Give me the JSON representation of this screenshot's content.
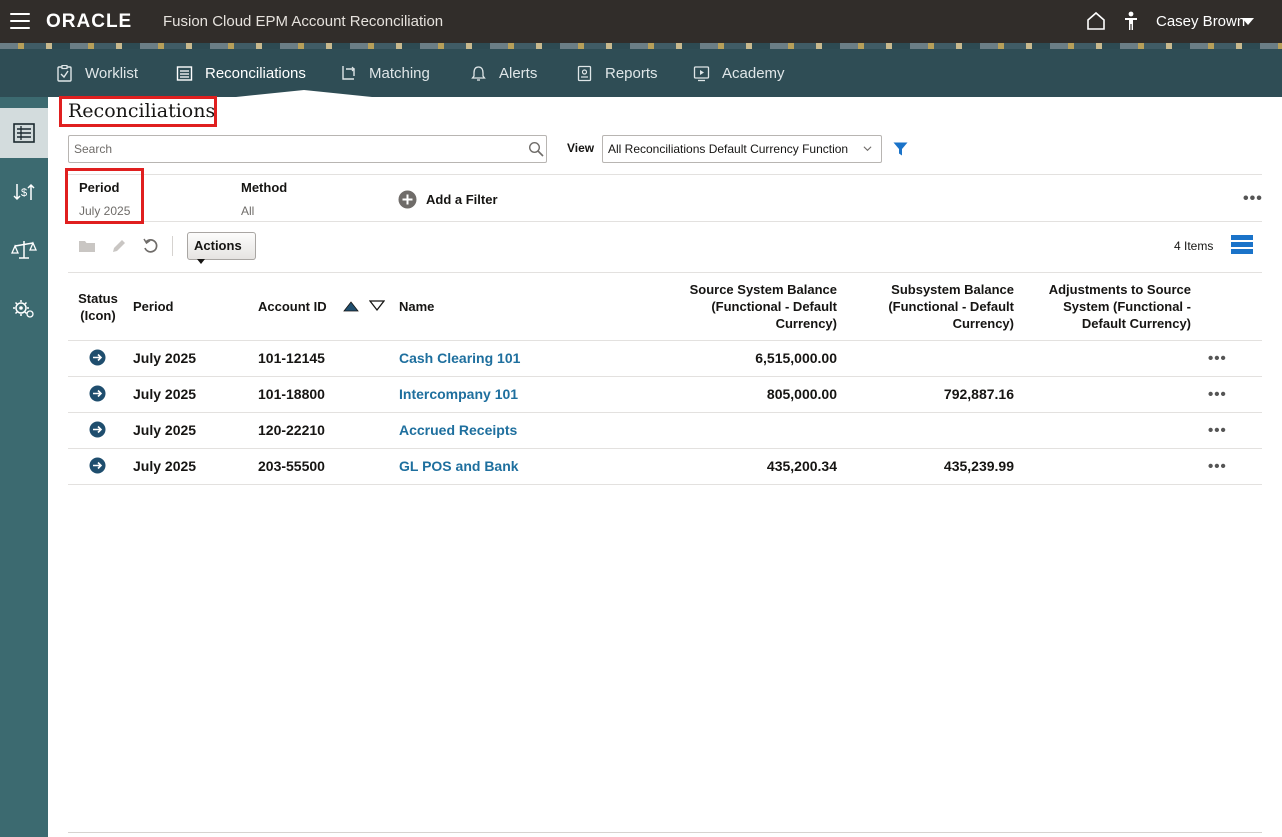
{
  "header": {
    "logo": "ORACLE",
    "app_title": "Fusion Cloud EPM Account Reconciliation",
    "user_name": "Casey Brown"
  },
  "nav": {
    "items": [
      {
        "label": "Worklist",
        "icon": "worklist-icon"
      },
      {
        "label": "Reconciliations",
        "icon": "reconciliations-icon",
        "active": true
      },
      {
        "label": "Matching",
        "icon": "matching-icon"
      },
      {
        "label": "Alerts",
        "icon": "bell-icon"
      },
      {
        "label": "Reports",
        "icon": "reports-icon"
      },
      {
        "label": "Academy",
        "icon": "academy-icon"
      }
    ]
  },
  "rail": {
    "items": [
      "reconciliation-list-icon",
      "currency-exchange-icon",
      "balance-scale-icon",
      "settings-gear-icon"
    ]
  },
  "page": {
    "title": "Reconciliations"
  },
  "search": {
    "placeholder": "Search",
    "value": ""
  },
  "view": {
    "label": "View",
    "selected": "All Reconciliations Default Currency Function"
  },
  "filters": {
    "period_label": "Period",
    "period_value": "July 2025",
    "method_label": "Method",
    "method_value": "All",
    "add_filter_label": "Add a Filter"
  },
  "toolbar": {
    "actions_label": "Actions",
    "item_count": "4 Items"
  },
  "table": {
    "columns": {
      "status": [
        "Status",
        "(Icon)"
      ],
      "period": "Period",
      "account_id": "Account ID",
      "name": "Name",
      "source_balance": [
        "Source System Balance",
        "(Functional - Default",
        "Currency)"
      ],
      "subsystem_balance": [
        "Subsystem Balance",
        "(Functional - Default",
        "Currency)"
      ],
      "adjustments": [
        "Adjustments to Source",
        "System (Functional -",
        "Default Currency)"
      ]
    },
    "rows": [
      {
        "period": "July 2025",
        "account_id": "101-12145",
        "name": "Cash Clearing 101",
        "source_balance": "6,515,000.00",
        "subsystem_balance": "",
        "adjustments": ""
      },
      {
        "period": "July 2025",
        "account_id": "101-18800",
        "name": "Intercompany 101",
        "source_balance": "805,000.00",
        "subsystem_balance": "792,887.16",
        "adjustments": ""
      },
      {
        "period": "July 2025",
        "account_id": "120-22210",
        "name": "Accrued Receipts",
        "source_balance": "",
        "subsystem_balance": "",
        "adjustments": ""
      },
      {
        "period": "July 2025",
        "account_id": "203-55500",
        "name": "GL POS and Bank",
        "source_balance": "435,200.34",
        "subsystem_balance": "435,239.99",
        "adjustments": ""
      }
    ]
  },
  "colors": {
    "header_bg": "#312d2a",
    "nav_bg": "#2f4d55",
    "rail_bg": "#3c6a70",
    "link": "#1e6f9e",
    "status_icon": "#1f4e6e",
    "highlight": "#e01f1f",
    "accent_blue": "#1a73c9"
  }
}
